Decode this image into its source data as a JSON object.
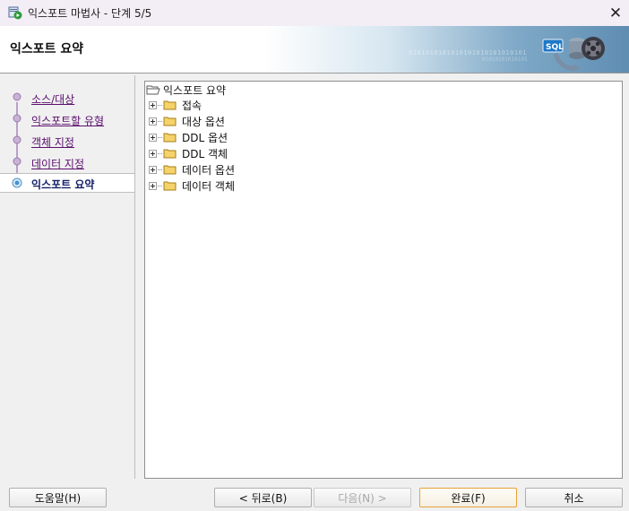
{
  "window": {
    "title": "익스포트 마법사 - 단계 5/5",
    "close_glyph": "✕"
  },
  "header": {
    "title": "익스포트 요약",
    "binary_text_1": "0101010101010101010101010101",
    "binary_text_2": "01010101010101"
  },
  "steps": [
    {
      "label": "소스/대상",
      "current": false
    },
    {
      "label": "익스포트할 유형",
      "current": false
    },
    {
      "label": "객체 지정",
      "current": false
    },
    {
      "label": "데이터 지정",
      "current": false
    },
    {
      "label": "익스포트 요약",
      "current": true
    }
  ],
  "tree": {
    "root_label": "익스포트 요약",
    "nodes": [
      {
        "label": "접속"
      },
      {
        "label": "대상 옵션"
      },
      {
        "label": "DDL 옵션"
      },
      {
        "label": "DDL 객체"
      },
      {
        "label": "데이터 옵션"
      },
      {
        "label": "데이터 객체"
      }
    ]
  },
  "buttons": {
    "help": "도움말(H)",
    "back": "< 뒤로(B)",
    "next": "다음(N) >",
    "finish": "완료(F)",
    "cancel": "취소"
  },
  "colors": {
    "link_visited": "#5b0f6e",
    "current_step": "#15216a",
    "folder_yellow": "#f5d26a",
    "default_button_border": "#e6a33a"
  }
}
